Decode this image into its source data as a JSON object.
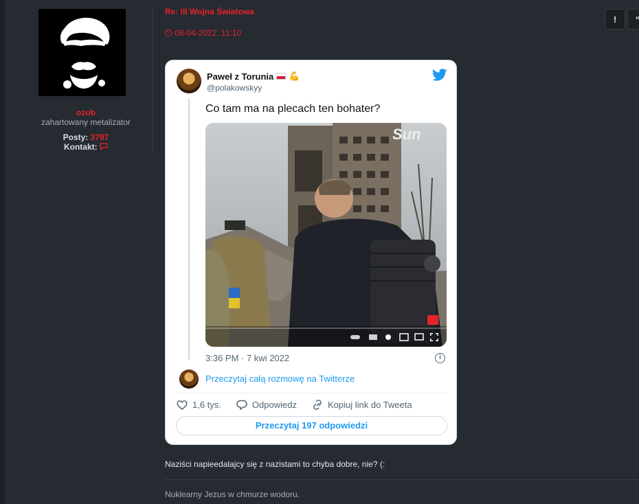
{
  "author": {
    "username": "ozob",
    "rank": "zahartowany metalizator",
    "posts_label": "Posty:",
    "posts_value": "3797",
    "contact_label": "Kontakt:"
  },
  "post": {
    "title": "Re: III Wojna Światowa",
    "date": "08-04-2022, 11:10",
    "report_label": "!",
    "quote_label": "“",
    "text": "Naziści napieedalajcy się z nazistami to chyba dobre, nie? (:",
    "signature": "Nuklearny Jezus w chmurze wodoru."
  },
  "tweet": {
    "name": "Paweł z Torunia",
    "handle": "@polakowskyy",
    "text": "Co tam ma na plecach ten bohater?",
    "media_watermark": "Sun",
    "time": "3:36 PM · 7 kwi 2022",
    "read_conversation": "Przeczytaj całą rozmowę na Twitterze",
    "likes": "1,6 tys.",
    "reply_label": "Odpowiedz",
    "copy_link_label": "Kopiuj link do Tweeta",
    "replies_button": "Przeczytaj 197 odpowiedzi"
  },
  "colors": {
    "accent": "#e8222b",
    "twitter_blue": "#1d9bf0",
    "background": "#262a31"
  }
}
